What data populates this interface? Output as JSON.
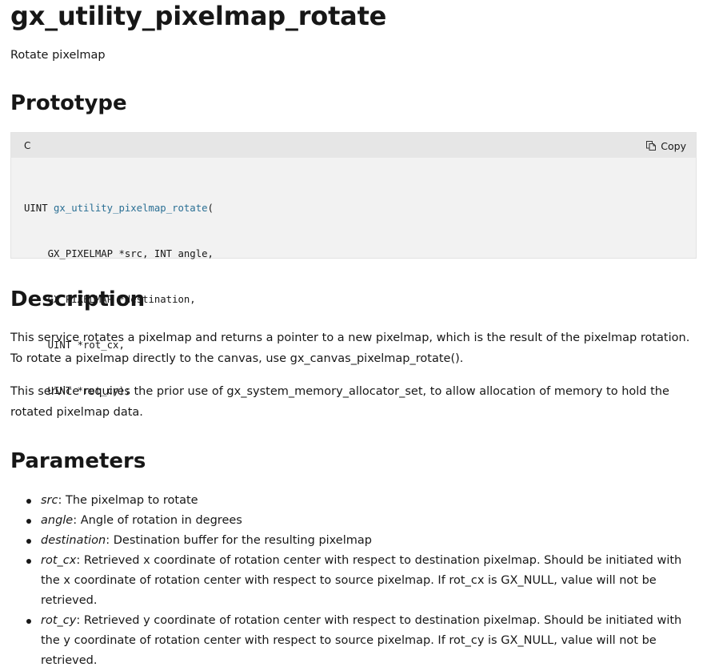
{
  "title": "gx_utility_pixelmap_rotate",
  "summary": "Rotate pixelmap",
  "sections": {
    "prototype": "Prototype",
    "description": "Description",
    "parameters": "Parameters"
  },
  "code": {
    "language": "C",
    "copy_label": "Copy",
    "lines": [
      {
        "pre": "UINT ",
        "fn": "gx_utility_pixelmap_rotate",
        "post": "("
      },
      {
        "pre": "    GX_PIXELMAP *src, INT angle,",
        "fn": "",
        "post": ""
      },
      {
        "pre": "    GX_PIXELMAP *destination,",
        "fn": "",
        "post": ""
      },
      {
        "pre": "    UINT *rot_cx,",
        "fn": "",
        "post": ""
      },
      {
        "pre": "    UINT *rot_cy);",
        "fn": "",
        "post": ""
      }
    ]
  },
  "description": {
    "p1": "This service rotates a pixelmap and returns a pointer to a new pixelmap, which is the result of the pixelmap rotation. To rotate a pixelmap directly to the canvas, use gx_canvas_pixelmap_rotate().",
    "p2": "This service requires the prior use of gx_system_memory_allocator_set, to allow allocation of memory to hold the rotated pixelmap data."
  },
  "parameters": [
    {
      "name": "src",
      "desc": ": The pixelmap to rotate"
    },
    {
      "name": "angle",
      "desc": ": Angle of rotation in degrees"
    },
    {
      "name": "destination",
      "desc": ": Destination buffer for the resulting pixelmap"
    },
    {
      "name": "rot_cx",
      "desc": ": Retrieved x coordinate of rotation center with respect to destination pixelmap. Should be initiated with the x coordinate of rotation center with respect to source pixelmap. If rot_cx is GX_NULL, value will not be retrieved."
    },
    {
      "name": "rot_cy",
      "desc": ": Retrieved y coordinate of rotation center with respect to destination pixelmap. Should be initiated with the y coordinate of rotation center with respect to source pixelmap. If rot_cy is GX_NULL, value will not be retrieved."
    }
  ],
  "icons": {
    "copy": "copy-icon"
  }
}
